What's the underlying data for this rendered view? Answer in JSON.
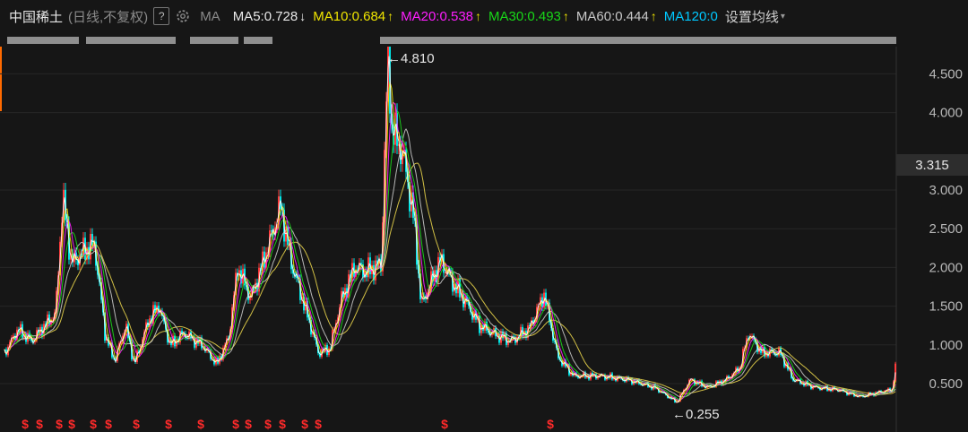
{
  "header": {
    "symbol": "中国稀土",
    "mode": "(日线,不复权)",
    "help": "?",
    "ma_label": "MA",
    "ma_items": [
      {
        "text": "MA5:0.728",
        "color": "#e8e8e8",
        "arrow": "↓"
      },
      {
        "text": "MA10:0.684",
        "color": "#f0e500",
        "arrow": "↑"
      },
      {
        "text": "MA20:0.538",
        "color": "#ff1eff",
        "arrow": "↑"
      },
      {
        "text": "MA30:0.493",
        "color": "#18d818",
        "arrow": "↑"
      },
      {
        "text": "MA60:0.444",
        "color": "#c8c8c8",
        "arrow": "↑"
      },
      {
        "text": "MA120:0",
        "color": "#00c8ff",
        "arrow": ""
      }
    ],
    "settings_label": "设置均线",
    "settings_caret": "▾"
  },
  "price_axis": {
    "ticks": [
      "4.500",
      "4.000",
      "3.000",
      "2.500",
      "2.000",
      "1.500",
      "1.000",
      "0.500"
    ],
    "current_price": "3.315"
  },
  "annotations": {
    "high": "←4.810",
    "low": "←0.255"
  },
  "dividend_marker": "$",
  "colors": {
    "background": "#161616",
    "up": "#ff3b3b",
    "down": "#00e5e5",
    "ma5": "#ffffff",
    "ma10": "#f0e500",
    "ma20": "#ff1eff",
    "ma30": "#18d818",
    "ma60": "#c8c8c8",
    "ma_long": "#e6d24a"
  }
}
